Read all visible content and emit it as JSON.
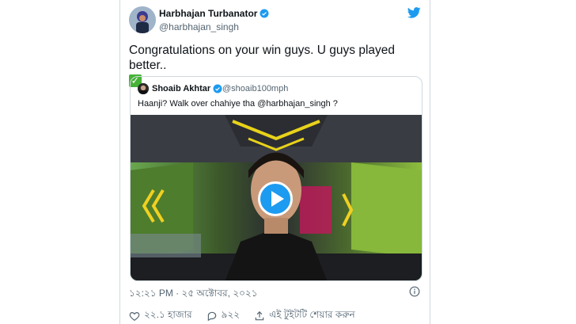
{
  "tweet": {
    "author_name": "Harbhajan Turbanator",
    "author_handle": "@harbhajan_singh",
    "text": "Congratulations on your win guys. U guys played better..",
    "emoji": "✓",
    "timestamp": "১২:২১ PM · ২৫ অক্টোবর, ২০২১"
  },
  "quoted": {
    "author_name": "Shoaib Akhtar",
    "author_handle": "@shoaib100mph",
    "text": "Haanji? Walk over chahiye tha @harbhajan_singh ?"
  },
  "actions": {
    "likes": "২২.১ হাজার",
    "replies": "৯২২",
    "share_label": "এই টুইটটি শেয়ার করুন"
  },
  "icons": {
    "verified": "verified-badge-icon",
    "logo": "twitter-bird-icon",
    "play": "play-icon",
    "info": "info-icon",
    "like": "heart-icon",
    "reply": "reply-bubble-icon",
    "share": "share-icon"
  },
  "colors": {
    "accent": "#1d9bf0",
    "text": "#0f1419",
    "secondary": "#536471",
    "check": "#46b337"
  }
}
